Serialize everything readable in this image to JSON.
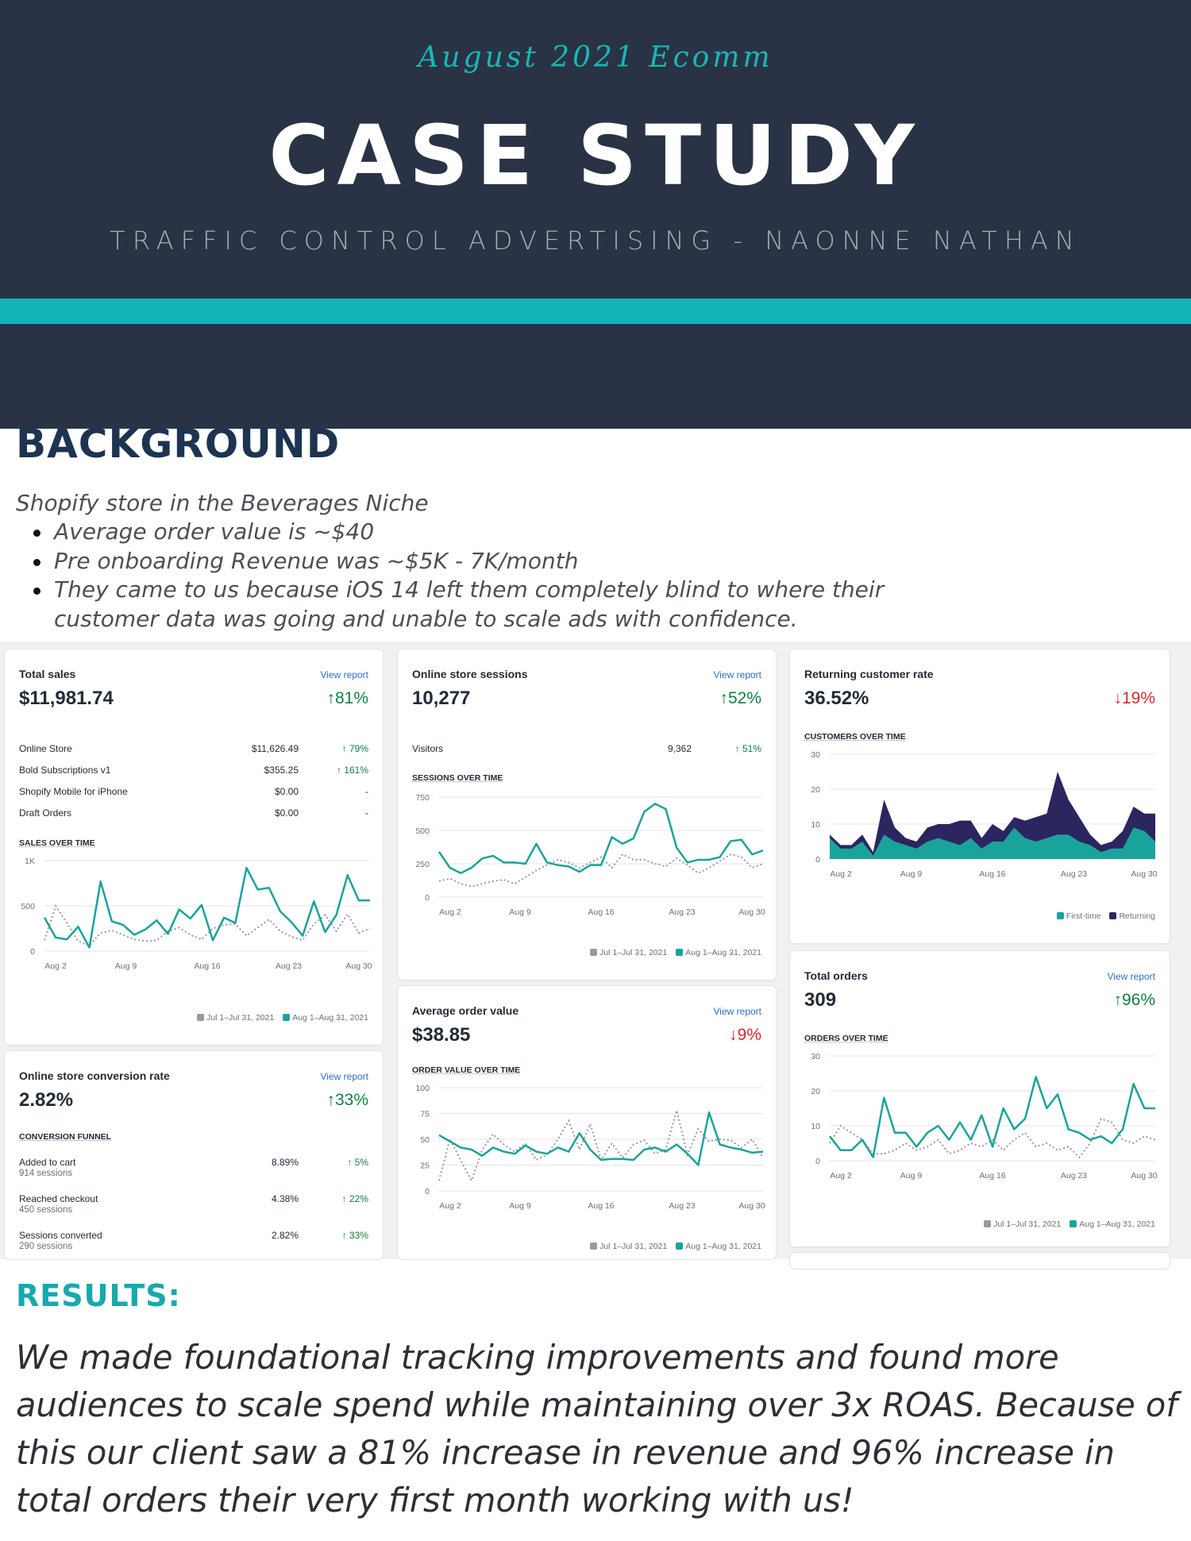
{
  "hero": {
    "subtitle": "August 2021 Ecomm",
    "title": "CASE STUDY",
    "byline": "TRAFFIC CONTROL ADVERTISING - NAONNE NATHAN"
  },
  "background": {
    "heading": "BACKGROUND",
    "intro": "Shopify store in the Beverages Niche",
    "bullets": [
      "Average order value is ~$40",
      " Pre onboarding Revenue was ~$5K - 7K/month",
      " They came to us because iOS 14 left them completely blind to where their customer data was going and unable to scale ads with confidence."
    ]
  },
  "colors": {
    "hero_bg": "#2a3345",
    "accent": "#13b3b8",
    "current": "#1aa39b",
    "previous": "#9a9a9a",
    "returning": "#2b2560",
    "up": "#108043",
    "down": "#d8292f"
  },
  "legend": {
    "prev": "Jul 1–Jul 31, 2021",
    "curr": "Aug 1–Aug 31, 2021",
    "first_time": "First-time",
    "returning": "Returning"
  },
  "cards": {
    "total_sales": {
      "title": "Total sales",
      "link": "View report",
      "value": "$11,981.74",
      "change": "↑81%",
      "rows": [
        {
          "label": "Online Store",
          "amount": "$11,626.49",
          "change": "↑ 79%"
        },
        {
          "label": "Bold Subscriptions v1",
          "amount": "$355.25",
          "change": "↑ 161%"
        },
        {
          "label": "Shopify Mobile for iPhone",
          "amount": "$0.00",
          "change": "-"
        },
        {
          "label": "Draft Orders",
          "amount": "$0.00",
          "change": "-"
        }
      ],
      "section": "SALES OVER TIME"
    },
    "conversion": {
      "title": "Online store conversion rate",
      "link": "View report",
      "value": "2.82%",
      "change": "↑33%",
      "section": "CONVERSION FUNNEL",
      "rows": [
        {
          "label": "Added to cart",
          "sub": "914 sessions",
          "amount": "8.89%",
          "change": "↑ 5%"
        },
        {
          "label": "Reached checkout",
          "sub": "450 sessions",
          "amount": "4.38%",
          "change": "↑ 22%"
        },
        {
          "label": "Sessions converted",
          "sub": "290 sessions",
          "amount": "2.82%",
          "change": "↑ 33%"
        }
      ]
    },
    "sessions": {
      "title": "Online store sessions",
      "link": "View report",
      "value": "10,277",
      "change": "↑52%",
      "rows": [
        {
          "label": "Visitors",
          "amount": "9,362",
          "change": "↑ 51%"
        }
      ],
      "section": "SESSIONS OVER TIME"
    },
    "aov": {
      "title": "Average order value",
      "link": "View report",
      "value": "$38.85",
      "change": "↓9%",
      "section": "ORDER VALUE OVER TIME"
    },
    "returning": {
      "title": "Returning customer rate",
      "value": "36.52%",
      "change": "↓19%",
      "section": "CUSTOMERS OVER TIME"
    },
    "orders": {
      "title": "Total orders",
      "link": "View report",
      "value": "309",
      "change": "↑96%",
      "section": "ORDERS OVER TIME"
    }
  },
  "chart_data": [
    {
      "id": "sales",
      "type": "line",
      "title": "SALES OVER TIME",
      "x_ticks": [
        "Aug 2",
        "Aug 9",
        "Aug 16",
        "Aug 23",
        "Aug 30"
      ],
      "y_ticks": [
        "0",
        "500",
        "1K"
      ],
      "ylim": [
        0,
        1000
      ],
      "series": [
        {
          "name": "Aug 1–Aug 31, 2021",
          "values": [
            370,
            150,
            130,
            270,
            40,
            770,
            330,
            290,
            180,
            240,
            340,
            190,
            460,
            360,
            510,
            120,
            370,
            310,
            920,
            680,
            700,
            440,
            320,
            170,
            550,
            210,
            400,
            840,
            560,
            560
          ]
        },
        {
          "name": "Jul 1–Jul 31, 2021",
          "values": [
            120,
            500,
            310,
            110,
            60,
            200,
            230,
            180,
            130,
            110,
            120,
            220,
            260,
            180,
            130,
            250,
            290,
            300,
            170,
            260,
            350,
            220,
            160,
            120,
            300,
            400,
            220,
            410,
            200,
            250
          ]
        }
      ]
    },
    {
      "id": "sessions",
      "type": "line",
      "title": "SESSIONS OVER TIME",
      "x_ticks": [
        "Aug 2",
        "Aug 9",
        "Aug 16",
        "Aug 23",
        "Aug 30"
      ],
      "y_ticks": [
        "0",
        "250",
        "500",
        "750"
      ],
      "ylim": [
        0,
        750
      ],
      "series": [
        {
          "name": "Aug 1–Aug 31, 2021",
          "values": [
            340,
            220,
            180,
            220,
            290,
            310,
            260,
            260,
            250,
            400,
            260,
            240,
            230,
            190,
            240,
            240,
            450,
            400,
            440,
            640,
            700,
            660,
            370,
            260,
            280,
            280,
            300,
            420,
            430,
            320,
            350
          ]
        },
        {
          "name": "Jul 1–Jul 31, 2021",
          "values": [
            120,
            140,
            100,
            80,
            100,
            120,
            130,
            100,
            150,
            200,
            240,
            280,
            260,
            220,
            260,
            300,
            220,
            320,
            280,
            280,
            250,
            230,
            290,
            240,
            180,
            220,
            270,
            320,
            300,
            220,
            250
          ]
        }
      ]
    },
    {
      "id": "aov",
      "type": "line",
      "title": "ORDER VALUE OVER TIME",
      "x_ticks": [
        "Aug 2",
        "Aug 9",
        "Aug 16",
        "Aug 23",
        "Aug 30"
      ],
      "y_ticks": [
        "0",
        "25",
        "50",
        "75",
        "100"
      ],
      "ylim": [
        0,
        100
      ],
      "series": [
        {
          "name": "Aug 1–Aug 31, 2021",
          "values": [
            54,
            48,
            42,
            40,
            34,
            42,
            38,
            36,
            44,
            38,
            36,
            42,
            38,
            56,
            40,
            30,
            31,
            31,
            30,
            40,
            42,
            38,
            45,
            36,
            25,
            76,
            45,
            42,
            40,
            37,
            38
          ]
        },
        {
          "name": "Jul 1–Jul 31, 2021",
          "values": [
            10,
            50,
            30,
            10,
            40,
            55,
            45,
            38,
            46,
            30,
            35,
            50,
            68,
            40,
            65,
            30,
            46,
            32,
            45,
            49,
            36,
            40,
            78,
            35,
            60,
            48,
            50,
            49,
            42,
            50,
            32
          ]
        }
      ]
    },
    {
      "id": "returning",
      "type": "area",
      "title": "CUSTOMERS OVER TIME",
      "x_ticks": [
        "Aug 2",
        "Aug 9",
        "Aug 16",
        "Aug 23",
        "Aug 30"
      ],
      "y_ticks": [
        "0",
        "10",
        "20",
        "30"
      ],
      "ylim": [
        0,
        30
      ],
      "series": [
        {
          "name": "First-time",
          "values": [
            6,
            3,
            3,
            5,
            1,
            7,
            5,
            4,
            3,
            5,
            6,
            5,
            4,
            6,
            3,
            5,
            5,
            9,
            6,
            5,
            6,
            7,
            7,
            5,
            4,
            2,
            3,
            3,
            9,
            8,
            5
          ]
        },
        {
          "name": "Returning",
          "values": [
            1,
            1,
            1,
            2,
            1,
            10,
            4,
            2,
            2,
            4,
            4,
            5,
            7,
            5,
            3,
            5,
            3,
            3,
            5,
            7,
            7,
            18,
            10,
            7,
            3,
            2,
            2,
            5,
            6,
            5,
            8
          ]
        }
      ]
    },
    {
      "id": "orders",
      "type": "line",
      "title": "ORDERS OVER TIME",
      "x_ticks": [
        "Aug 2",
        "Aug 9",
        "Aug 16",
        "Aug 23",
        "Aug 30"
      ],
      "y_ticks": [
        "0",
        "10",
        "20",
        "30"
      ],
      "ylim": [
        0,
        30
      ],
      "series": [
        {
          "name": "Aug 1–Aug 31, 2021",
          "values": [
            7,
            3,
            3,
            6,
            1,
            18,
            8,
            8,
            4,
            8,
            10,
            6,
            11,
            6,
            13,
            4,
            15,
            9,
            12,
            24,
            15,
            19,
            9,
            8,
            6,
            7,
            5,
            9,
            22,
            15,
            15
          ]
        },
        {
          "name": "Jul 1–Jul 31, 2021",
          "values": [
            5,
            10,
            8,
            6,
            2,
            2,
            3,
            5,
            3,
            4,
            6,
            2,
            3,
            5,
            4,
            6,
            3,
            6,
            8,
            4,
            5,
            3,
            4,
            1,
            5,
            12,
            11,
            6,
            5,
            7,
            6
          ]
        }
      ]
    }
  ],
  "results": {
    "heading": "RESULTS:",
    "text": "We made foundational tracking improvements and found more audiences to scale spend while maintaining over 3x ROAS. Because of this our client saw a 81% increase in revenue and 96% increase in total orders their very first month working with us!"
  }
}
